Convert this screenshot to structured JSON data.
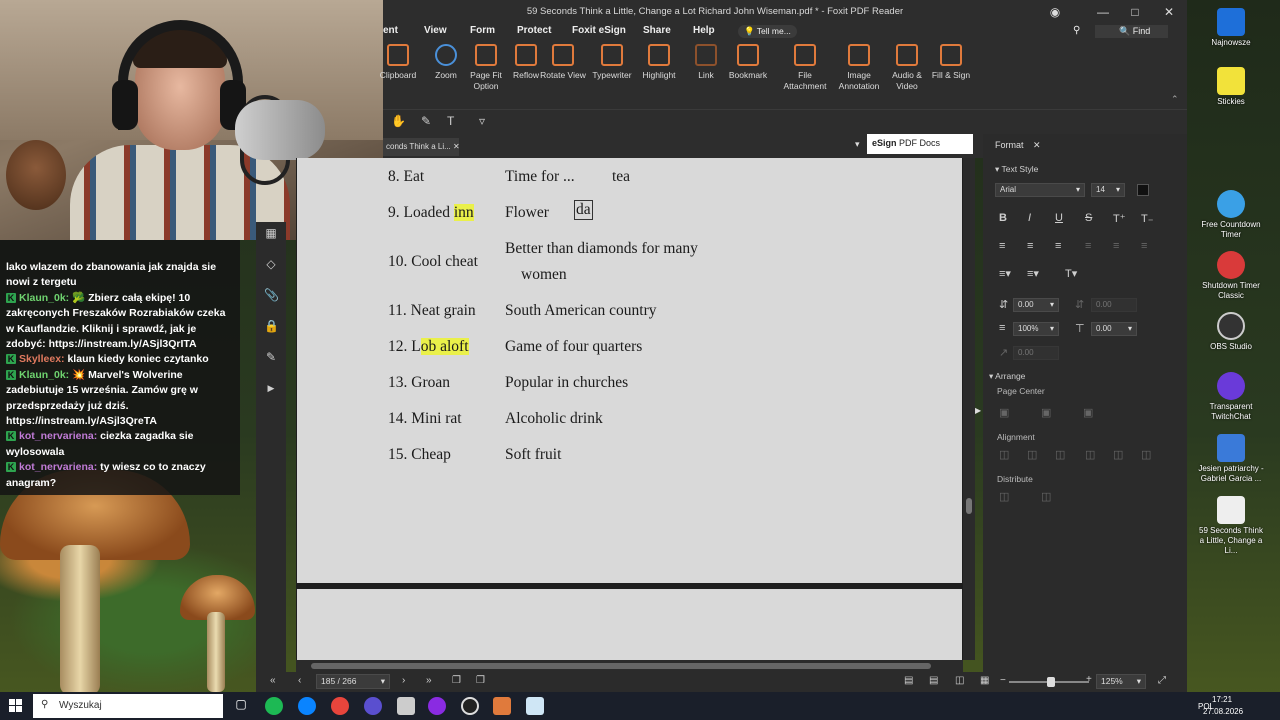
{
  "window": {
    "title": "59 Seconds Think a Little, Change a Lot Richard John Wiseman.pdf * - Foxit PDF Reader",
    "find_label": "Find"
  },
  "menu": [
    "ent",
    "View",
    "Form",
    "Protect",
    "Foxit eSign",
    "Share",
    "Help"
  ],
  "tell_me": "Tell me...",
  "ribbon": [
    {
      "label": "Clipboard",
      "icon": "clipboard-icon"
    },
    {
      "label": "Zoom",
      "icon": "zoom-icon"
    },
    {
      "label": "Page Fit Option",
      "icon": "page-fit-icon"
    },
    {
      "label": "Reflow",
      "icon": "reflow-icon"
    },
    {
      "label": "Rotate View",
      "icon": "rotate-icon"
    },
    {
      "label": "Typewriter",
      "icon": "typewriter-icon"
    },
    {
      "label": "Highlight",
      "icon": "highlight-icon"
    },
    {
      "label": "Link",
      "icon": "link-icon"
    },
    {
      "label": "Bookmark",
      "icon": "bookmark-icon"
    },
    {
      "label": "File Attachment",
      "icon": "file-attachment-icon"
    },
    {
      "label": "Image Annotation",
      "icon": "image-annotation-icon"
    },
    {
      "label": "Audio & Video",
      "icon": "audio-video-icon"
    },
    {
      "label": "Fill & Sign",
      "icon": "fill-sign-icon"
    }
  ],
  "doc_tab": "conds Think a Li...",
  "esign": {
    "brand": "eSign",
    "label": "PDF Docs"
  },
  "rows": [
    {
      "num": "8. Eat",
      "clue": "Time for ...",
      "answer": "tea"
    },
    {
      "num_pre": "9. Loaded ",
      "num_hl": "inn",
      "clue": "Flower",
      "answer": "da"
    },
    {
      "num": "10. Cool cheat",
      "clue": "Better than diamonds for many",
      "clue2": "women"
    },
    {
      "num": "11. Neat grain",
      "clue": "South American country"
    },
    {
      "num_pre": "12. L",
      "num_hl": "ob aloft",
      "clue": "Game of four quarters"
    },
    {
      "num": "13. Groan",
      "clue": "Popular in churches"
    },
    {
      "num": "14. Mini rat",
      "clue": "Alcoholic drink"
    },
    {
      "num": "15. Cheap",
      "clue": "Soft fruit"
    }
  ],
  "format_panel": {
    "tab": "Format",
    "text_style": "Text Style",
    "font": "Arial",
    "size": "14",
    "spacing1": "0.00",
    "scale": "100%",
    "spacing2": "0.00",
    "spacing3": "0.00",
    "rise": "0.00",
    "arrange": "Arrange",
    "page_center": "Page Center",
    "alignment": "Alignment",
    "distribute": "Distribute"
  },
  "status": {
    "page": "185 / 266",
    "zoom": "125%"
  },
  "chat": [
    {
      "user": "",
      "text": "lako wlazem do zbanowania jak znajda sie nowi z tergetu"
    },
    {
      "user": "Klaun_0k:",
      "text": "🥦 Zbierz całą ekipę! 10 zakręconych Freszaków Rozrabiaków czeka w Kauflandzie. Kliknij i sprawdź, jak je zdobyć: https://instream.ly/ASjl3QrITA"
    },
    {
      "user": "Skylleex:",
      "text": "klaun kiedy koniec czytanko",
      "color": "red"
    },
    {
      "user": "Klaun_0k:",
      "text": "💥 Marvel's Wolverine zadebiutuje 15 września. Zamów grę w przedsprzedaży już dziś. https://instream.ly/ASjl3QreTA"
    },
    {
      "user": "kot_nervariena:",
      "text": "ciezka zagadka sie wylosowala",
      "color": "pink"
    },
    {
      "user": "kot_nervariena:",
      "text": "ty wiesz co to znaczy anagram?",
      "color": "pink"
    }
  ],
  "desktop_icons": [
    {
      "name": "Najnowsze",
      "color": "#1e6fd9"
    },
    {
      "name": "Stickies",
      "color": "#f2e23a"
    },
    {
      "name": "Free Countdown Timer",
      "color": "#3aa0e6"
    },
    {
      "name": "Shutdown Timer Classic",
      "color": "#d93a3a"
    },
    {
      "name": "OBS Studio",
      "color": "#333333"
    },
    {
      "name": "Transparent TwitchChat",
      "color": "#6a3ad9"
    },
    {
      "name": "Jesien patriarchy - Gabriel Garcia ...",
      "color": "#3a7ad9"
    },
    {
      "name": "59 Seconds Think a Little, Change a Li...",
      "color": "#eeeeee"
    }
  ],
  "taskbar": {
    "search": "Wyszukaj",
    "lang": "POL",
    "time": "17:21",
    "date": "27.08.2026"
  }
}
